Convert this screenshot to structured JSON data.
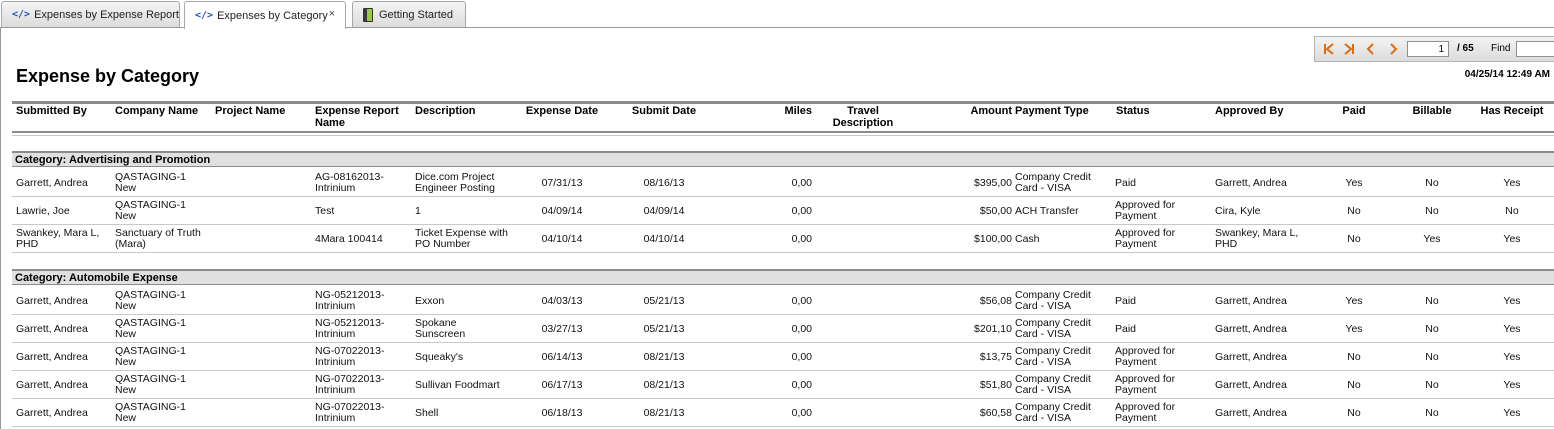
{
  "tabs": [
    {
      "label": "Expenses by Expense Report",
      "icon": "code-icon"
    },
    {
      "label": "Expenses by Category",
      "icon": "code-icon",
      "active": true,
      "close": "×"
    },
    {
      "label": "Getting Started",
      "icon": "getting-started-icon"
    }
  ],
  "pager": {
    "page": "1",
    "total": "/ 65",
    "find_label": "Find",
    "find_value": ""
  },
  "report": {
    "title": "Expense by Category",
    "date": "04/25/14 12:49 AM"
  },
  "columns": {
    "submitted_by": "Submitted By",
    "company": "Company Name",
    "project": "Project Name",
    "report_name": [
      "Expense Report",
      "Name"
    ],
    "description": "Description",
    "expense_date": "Expense Date",
    "submit_date": "Submit Date",
    "miles": "Miles",
    "travel_desc": [
      "Travel",
      "Description"
    ],
    "amount": "Amount",
    "payment_type": "Payment Type",
    "status": "Status",
    "approved_by": "Approved By",
    "paid": "Paid",
    "billable": "Billable",
    "has_receipt": "Has Receipt"
  },
  "categories": [
    {
      "label": "Category: Advertising and Promotion",
      "rows": [
        {
          "submitted_by": [
            "Garrett, Andrea"
          ],
          "company": [
            "QASTAGING-1",
            "New"
          ],
          "project": "",
          "report_name": [
            "AG-08162013-",
            "Intrinium"
          ],
          "description": [
            "Dice.com Project",
            "Engineer Posting"
          ],
          "expense_date": "07/31/13",
          "submit_date": "08/16/13",
          "miles": "0,00",
          "travel_desc": "",
          "amount": "$395,00",
          "payment_type": [
            "Company Credit",
            "Card - VISA"
          ],
          "status": [
            "Paid"
          ],
          "approved_by": [
            "Garrett, Andrea"
          ],
          "paid": "Yes",
          "billable": "No",
          "has_receipt": "Yes"
        },
        {
          "submitted_by": [
            "Lawrie, Joe"
          ],
          "company": [
            "QASTAGING-1",
            "New"
          ],
          "project": "",
          "report_name": [
            "Test"
          ],
          "description": [
            "1"
          ],
          "expense_date": "04/09/14",
          "submit_date": "04/09/14",
          "miles": "0,00",
          "travel_desc": "",
          "amount": "$50,00",
          "payment_type": [
            "ACH Transfer"
          ],
          "status": [
            "Approved for",
            "Payment"
          ],
          "approved_by": [
            "Cira, Kyle"
          ],
          "paid": "No",
          "billable": "No",
          "has_receipt": "No"
        },
        {
          "submitted_by": [
            "Swankey, Mara L,",
            "PHD"
          ],
          "company": [
            "Sanctuary of Truth",
            "(Mara)"
          ],
          "project": "",
          "report_name": [
            "4Mara 100414"
          ],
          "description": [
            "Ticket Expense with",
            "PO Number"
          ],
          "expense_date": "04/10/14",
          "submit_date": "04/10/14",
          "miles": "0,00",
          "travel_desc": "",
          "amount": "$100,00",
          "payment_type": [
            "Cash"
          ],
          "status": [
            "Approved for",
            "Payment"
          ],
          "approved_by": [
            "Swankey, Mara L,",
            "PHD"
          ],
          "paid": "No",
          "billable": "Yes",
          "has_receipt": "Yes"
        }
      ]
    },
    {
      "label": "Category: Automobile Expense",
      "rows": [
        {
          "submitted_by": [
            "Garrett, Andrea"
          ],
          "company": [
            "QASTAGING-1",
            "New"
          ],
          "project": "",
          "report_name": [
            "NG-05212013-",
            "Intrinium"
          ],
          "description": [
            "Exxon"
          ],
          "expense_date": "04/03/13",
          "submit_date": "05/21/13",
          "miles": "0,00",
          "travel_desc": "",
          "amount": "$56,08",
          "payment_type": [
            "Company Credit",
            "Card - VISA"
          ],
          "status": [
            "Paid"
          ],
          "approved_by": [
            "Garrett, Andrea"
          ],
          "paid": "Yes",
          "billable": "No",
          "has_receipt": "Yes"
        },
        {
          "submitted_by": [
            "Garrett, Andrea"
          ],
          "company": [
            "QASTAGING-1",
            "New"
          ],
          "project": "",
          "report_name": [
            "NG-05212013-",
            "Intrinium"
          ],
          "description": [
            "Spokane",
            "Sunscreen"
          ],
          "expense_date": "03/27/13",
          "submit_date": "05/21/13",
          "miles": "0,00",
          "travel_desc": "",
          "amount": "$201,10",
          "payment_type": [
            "Company Credit",
            "Card - VISA"
          ],
          "status": [
            "Paid"
          ],
          "approved_by": [
            "Garrett, Andrea"
          ],
          "paid": "Yes",
          "billable": "No",
          "has_receipt": "Yes"
        },
        {
          "submitted_by": [
            "Garrett, Andrea"
          ],
          "company": [
            "QASTAGING-1",
            "New"
          ],
          "project": "",
          "report_name": [
            "NG-07022013-",
            "Intrinium"
          ],
          "description": [
            "Squeaky's"
          ],
          "expense_date": "06/14/13",
          "submit_date": "08/21/13",
          "miles": "0,00",
          "travel_desc": "",
          "amount": "$13,75",
          "payment_type": [
            "Company Credit",
            "Card - VISA"
          ],
          "status": [
            "Approved for",
            "Payment"
          ],
          "approved_by": [
            "Garrett, Andrea"
          ],
          "paid": "No",
          "billable": "No",
          "has_receipt": "Yes"
        },
        {
          "submitted_by": [
            "Garrett, Andrea"
          ],
          "company": [
            "QASTAGING-1",
            "New"
          ],
          "project": "",
          "report_name": [
            "NG-07022013-",
            "Intrinium"
          ],
          "description": [
            "Sullivan Foodmart"
          ],
          "expense_date": "06/17/13",
          "submit_date": "08/21/13",
          "miles": "0,00",
          "travel_desc": "",
          "amount": "$51,80",
          "payment_type": [
            "Company Credit",
            "Card - VISA"
          ],
          "status": [
            "Approved for",
            "Payment"
          ],
          "approved_by": [
            "Garrett, Andrea"
          ],
          "paid": "No",
          "billable": "No",
          "has_receipt": "Yes"
        },
        {
          "submitted_by": [
            "Garrett, Andrea"
          ],
          "company": [
            "QASTAGING-1",
            "New"
          ],
          "project": "",
          "report_name": [
            "NG-07022013-",
            "Intrinium"
          ],
          "description": [
            "Shell"
          ],
          "expense_date": "06/18/13",
          "submit_date": "08/21/13",
          "miles": "0,00",
          "travel_desc": "",
          "amount": "$60,58",
          "payment_type": [
            "Company Credit",
            "Card - VISA"
          ],
          "status": [
            "Approved for",
            "Payment"
          ],
          "approved_by": [
            "Garrett, Andrea"
          ],
          "paid": "No",
          "billable": "No",
          "has_receipt": "Yes"
        }
      ]
    }
  ]
}
